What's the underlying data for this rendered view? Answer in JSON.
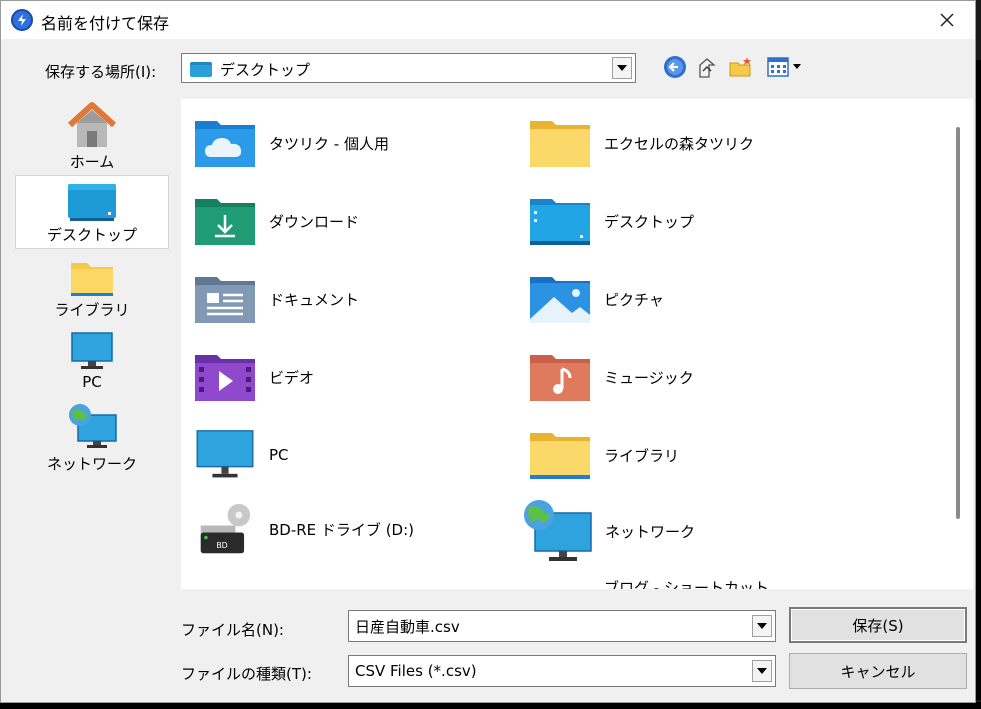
{
  "window": {
    "title": "名前を付けて保存"
  },
  "save_in": {
    "label": "保存する場所(I):",
    "value": "デスクトップ"
  },
  "toolbar": {
    "icons": [
      "back-icon",
      "up-folder-icon",
      "new-folder-icon",
      "view-menu-icon"
    ]
  },
  "places": [
    {
      "label": "ホーム",
      "icon": "home-icon"
    },
    {
      "label": "デスクトップ",
      "icon": "desktop-icon",
      "selected": true
    },
    {
      "label": "ライブラリ",
      "icon": "library-icon"
    },
    {
      "label": "PC",
      "icon": "pc-icon"
    },
    {
      "label": "ネットワーク",
      "icon": "network-icon"
    }
  ],
  "items": [
    {
      "name": "タツリク - 個人用",
      "icon": "onedrive-folder-icon"
    },
    {
      "name": "エクセルの森タツリク",
      "icon": "folder-icon"
    },
    {
      "name": "ダウンロード",
      "icon": "downloads-folder-icon"
    },
    {
      "name": "デスクトップ",
      "icon": "desktop-folder-icon"
    },
    {
      "name": "ドキュメント",
      "icon": "documents-folder-icon"
    },
    {
      "name": "ピクチャ",
      "icon": "pictures-folder-icon"
    },
    {
      "name": "ビデオ",
      "icon": "videos-folder-icon"
    },
    {
      "name": "ミュージック",
      "icon": "music-folder-icon"
    },
    {
      "name": "PC",
      "icon": "pc-icon"
    },
    {
      "name": "ライブラリ",
      "icon": "library-folder-icon"
    },
    {
      "name": "BD-RE ドライブ (D:)",
      "icon": "bd-drive-icon"
    },
    {
      "name": "ネットワーク",
      "icon": "network-icon"
    },
    {
      "name": "",
      "icon": "folder-icon"
    },
    {
      "name": "ブログ - ショートカット",
      "icon": "folder-icon"
    }
  ],
  "file_name": {
    "label": "ファイル名(N):",
    "value": "日産自動車.csv"
  },
  "file_type": {
    "label": "ファイルの種類(T):",
    "value": "CSV Files (*.csv)"
  },
  "buttons": {
    "save": "保存(S)",
    "cancel": "キャンセル"
  },
  "colors": {
    "folder_yellow": "#f7c948",
    "accent_blue": "#1f87c4",
    "selection": "#ffffff"
  }
}
